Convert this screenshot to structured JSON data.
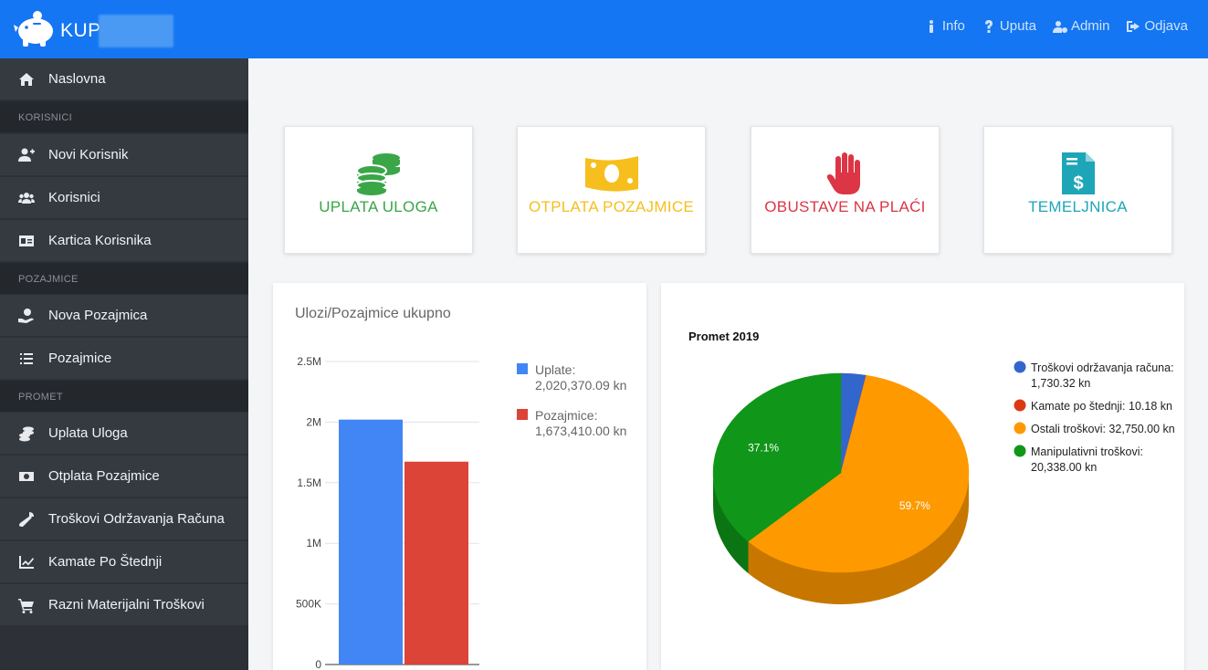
{
  "header": {
    "brand": "KUP",
    "nav": [
      {
        "label": "Info",
        "icon": "info-icon"
      },
      {
        "label": "Uputa",
        "icon": "question-icon"
      },
      {
        "label": "Admin",
        "icon": "users-cog-icon"
      },
      {
        "label": "Odjava",
        "icon": "sign-out-icon"
      }
    ]
  },
  "sidebar": {
    "home": "Naslovna",
    "sections": [
      {
        "title": "KORISNICI",
        "items": [
          "Novi Korisnik",
          "Korisnici",
          "Kartica Korisnika"
        ]
      },
      {
        "title": "POZAJMICE",
        "items": [
          "Nova Pozajmica",
          "Pozajmice"
        ]
      },
      {
        "title": "PROMET",
        "items": [
          "Uplata Uloga",
          "Otplata Pozajmice",
          "Troškovi Održavanja Računa",
          "Kamate Po Štednji",
          "Razni Materijalni Troškovi"
        ]
      }
    ]
  },
  "cards": [
    {
      "label": "UPLATA ULOGA",
      "color": "#3aa648",
      "icon": "coins-icon"
    },
    {
      "label": "OTPLATA POZAJMICE",
      "color": "#f6bf1e",
      "icon": "money-bill-icon"
    },
    {
      "label": "OBUSTAVE NA PLAĆI",
      "color": "#dc3545",
      "icon": "hand-icon"
    },
    {
      "label": "TEMELJNICA",
      "color": "#1ea5b8",
      "icon": "invoice-icon"
    }
  ],
  "chart_data": [
    {
      "type": "bar",
      "title": "Ulozi/Pozajmice ukupno",
      "series": [
        {
          "name": "Uplate: 2,020,370.09 kn",
          "value": 2020370.09,
          "color": "#4285f4"
        },
        {
          "name": "Pozajmice: 1,673,410.00 kn",
          "value": 1673410.0,
          "color": "#db4437"
        }
      ],
      "ylim": [
        0,
        2500000
      ],
      "ytick_labels": [
        "0",
        "500K",
        "1M",
        "1.5M",
        "2M",
        "2.5M"
      ],
      "grid": true,
      "legend": "right"
    },
    {
      "type": "pie",
      "title": "Promet 2019",
      "slices": [
        {
          "name": "Troškovi održavanja računa: 1,730.32 kn",
          "value": 1730.32,
          "color": "#3366cc"
        },
        {
          "name": "Kamate po štednji: 10.18 kn",
          "value": 10.18,
          "color": "#dc3912"
        },
        {
          "name": "Ostali troškovi: 32,750.00 kn",
          "value": 32750.0,
          "color": "#ff9900"
        },
        {
          "name": "Manipulativni troškovi: 20,338.00 kn",
          "value": 20338.0,
          "color": "#109618"
        }
      ],
      "slice_labels": [
        "59.7%",
        "37.1%"
      ],
      "is3D": true,
      "legend": "right"
    }
  ]
}
